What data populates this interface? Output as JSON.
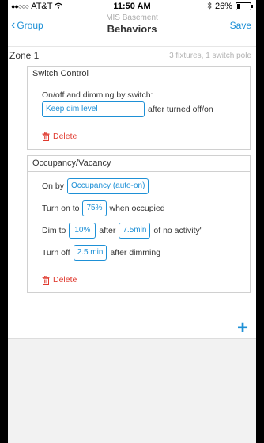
{
  "status_bar": {
    "carrier": "AT&T",
    "time": "11:50 AM",
    "battery_percent": "26%",
    "battery_level": 0.26
  },
  "nav": {
    "back_label": "Group",
    "subtitle": "MIS Basement",
    "title": "Behaviors",
    "save_label": "Save"
  },
  "zone": {
    "name": "Zone 1",
    "info": "3 fixtures, 1 switch pole"
  },
  "switch_control": {
    "header": "Switch Control",
    "description": "On/off and dimming by switch:",
    "mode_value": "Keep dim level",
    "mode_suffix": "after turned off/on",
    "delete_label": "Delete"
  },
  "occupancy": {
    "header": "Occupancy/Vacancy",
    "on_by_label": "On by",
    "on_by_value": "Occupancy (auto-on)",
    "turn_on_label": "Turn on to",
    "turn_on_value": "75%",
    "turn_on_suffix": "when occupied",
    "dim_to_label": "Dim to",
    "dim_to_value": "10%",
    "dim_after_label": "after",
    "dim_after_value": "7.5min",
    "dim_suffix": "of no activity\"",
    "turn_off_label": "Turn off",
    "turn_off_value": "2.5 min",
    "turn_off_suffix": "after dimming",
    "delete_label": "Delete"
  },
  "add_button": "+",
  "colors": {
    "accent": "#1e90d6",
    "delete": "#e03a2f"
  }
}
